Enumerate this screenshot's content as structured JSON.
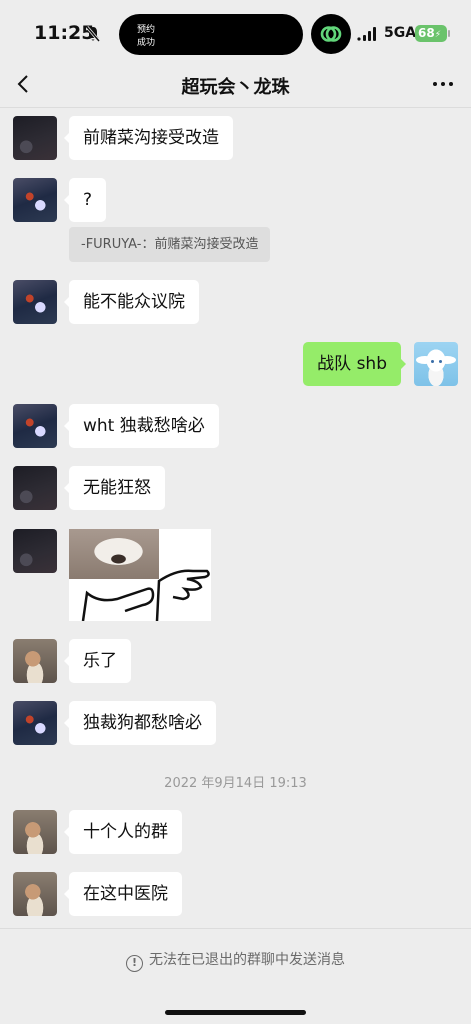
{
  "status_bar": {
    "time": "11:25",
    "island_line1": "预约",
    "island_line2": "成功",
    "network": "5GA",
    "battery": "68"
  },
  "nav": {
    "title": "超玩会丶龙珠"
  },
  "messages": [
    {
      "side": "left",
      "avatar": "night-sky",
      "text": "前赌菜沟接受改造"
    },
    {
      "side": "left",
      "avatar": "volcano-figure",
      "text": "?",
      "quote": "-FURUYA-：前赌菜沟接受改造"
    },
    {
      "side": "left",
      "avatar": "volcano-figure",
      "text": "能不能众议院"
    },
    {
      "side": "right",
      "avatar": "cinnamoroll",
      "text": "战队 shb"
    },
    {
      "side": "left",
      "avatar": "volcano-figure",
      "text": "wht 独裁愁啥必"
    },
    {
      "side": "left",
      "avatar": "night-sky",
      "text": "无能狂怒"
    },
    {
      "side": "left",
      "avatar": "night-sky",
      "type": "sticker",
      "sticker": "cat-pointing"
    },
    {
      "side": "left",
      "avatar": "bird-reading",
      "text": "乐了"
    },
    {
      "side": "left",
      "avatar": "volcano-figure",
      "text": "独裁狗都愁啥必"
    },
    {
      "side": "left",
      "avatar": "bird-reading",
      "text": "十个人的群"
    },
    {
      "side": "left",
      "avatar": "bird-reading",
      "text": "在这中医院"
    }
  ],
  "timestamp": "2022 年9月14日 19:13",
  "footer": {
    "notice": "无法在已退出的群聊中发送消息",
    "notice_icon": "warning-circle-icon"
  }
}
